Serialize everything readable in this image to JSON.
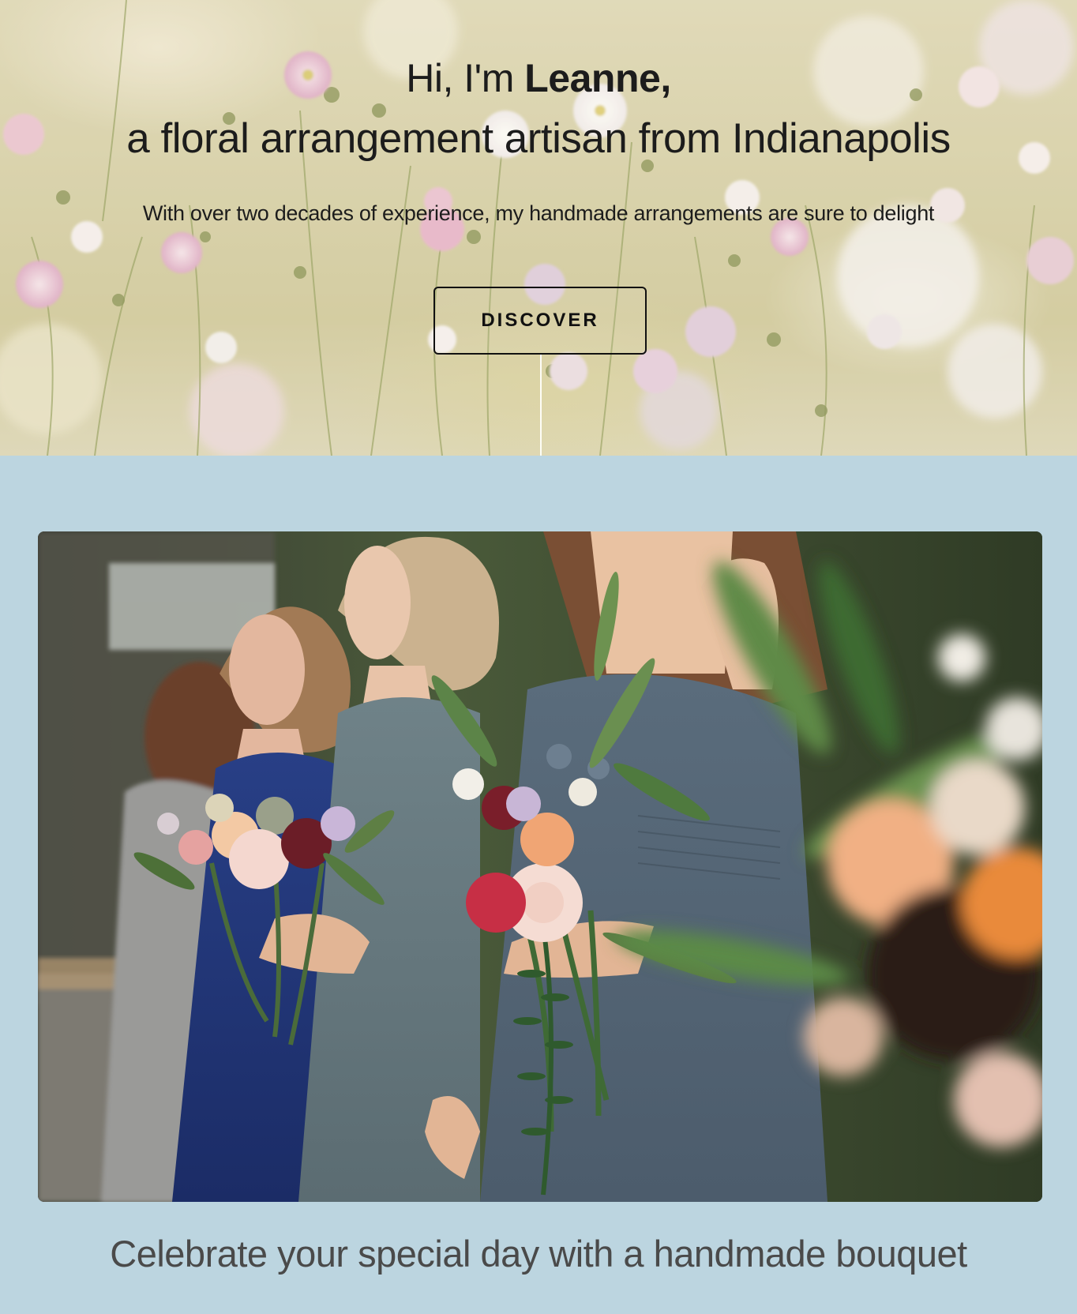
{
  "hero": {
    "greeting_prefix": "Hi, I'm ",
    "name": "Leanne,",
    "tagline": "a floral arrangement artisan from Indianapolis",
    "subtitle": "With over two decades of experience, my handmade arrangements are sure to delight",
    "cta_label": "DISCOVER"
  },
  "feature": {
    "heading": "Celebrate your special day with a handmade bouquet"
  },
  "colors": {
    "section_background": "#bcd5e0",
    "heading_text": "#4a4a4a",
    "hero_text": "#1c1c1c"
  }
}
